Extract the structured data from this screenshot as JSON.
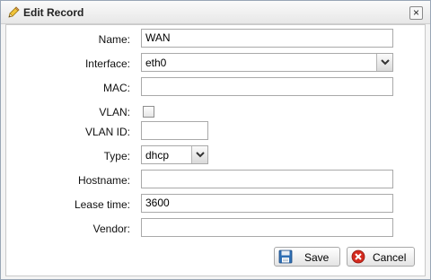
{
  "window": {
    "title": "Edit Record",
    "close_label": "×",
    "title_icon": "pencil-icon"
  },
  "form": {
    "name": {
      "label": "Name:",
      "value": "WAN"
    },
    "interface": {
      "label": "Interface:",
      "value": "eth0"
    },
    "mac": {
      "label": "MAC:",
      "value": ""
    },
    "vlan": {
      "label": "VLAN:",
      "checked": false
    },
    "vlan_id": {
      "label": "VLAN ID:",
      "value": ""
    },
    "type": {
      "label": "Type:",
      "value": "dhcp"
    },
    "hostname": {
      "label": "Hostname:",
      "value": ""
    },
    "lease_time": {
      "label": "Lease time:",
      "value": "3600"
    },
    "vendor": {
      "label": "Vendor:",
      "value": ""
    }
  },
  "buttons": {
    "save_label": "Save",
    "save_icon": "floppy-disk-icon",
    "cancel_label": "Cancel",
    "cancel_icon": "red-x-circle-icon"
  },
  "colors": {
    "save_icon_blue": "#2f6fb4",
    "cancel_icon_red": "#d42a1e"
  }
}
